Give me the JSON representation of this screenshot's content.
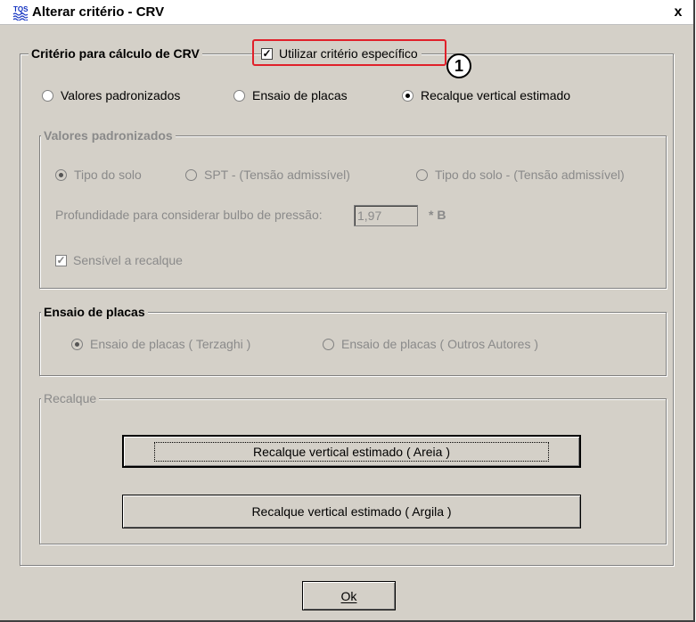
{
  "window": {
    "title": "Alterar critério - CRV",
    "close_label": "x"
  },
  "criterio_group": {
    "label": "Critério para cálculo de CRV",
    "use_specific_label": "Utilizar critério específico",
    "use_specific_checked": true,
    "callout_number": "1",
    "options": [
      {
        "label": "Valores padronizados",
        "selected": false
      },
      {
        "label": "Ensaio de placas",
        "selected": false
      },
      {
        "label": "Recalque vertical estimado",
        "selected": true
      }
    ]
  },
  "valores_group": {
    "label": "Valores padronizados",
    "options": [
      {
        "label": "Tipo do solo",
        "selected": true
      },
      {
        "label": "SPT - (Tensão admissível)",
        "selected": false
      },
      {
        "label": "Tipo do solo -  (Tensão admissível)",
        "selected": false
      }
    ],
    "depth_label": "Profundidade para considerar bulbo de pressão:",
    "depth_value": "1,97",
    "depth_unit": "* B",
    "sensitive_label": "Sensível a recalque",
    "sensitive_checked": true
  },
  "ensaio_group": {
    "label": "Ensaio de placas",
    "options": [
      {
        "label": "Ensaio de placas ( Terzaghi )",
        "selected": true
      },
      {
        "label": "Ensaio de placas ( Outros Autores )",
        "selected": false
      }
    ]
  },
  "recalque_group": {
    "label": "Recalque",
    "button_areia": "Recalque vertical estimado ( Areia )",
    "button_argila": "Recalque vertical estimado ( Argila )"
  },
  "footer": {
    "ok_label": "Ok"
  }
}
